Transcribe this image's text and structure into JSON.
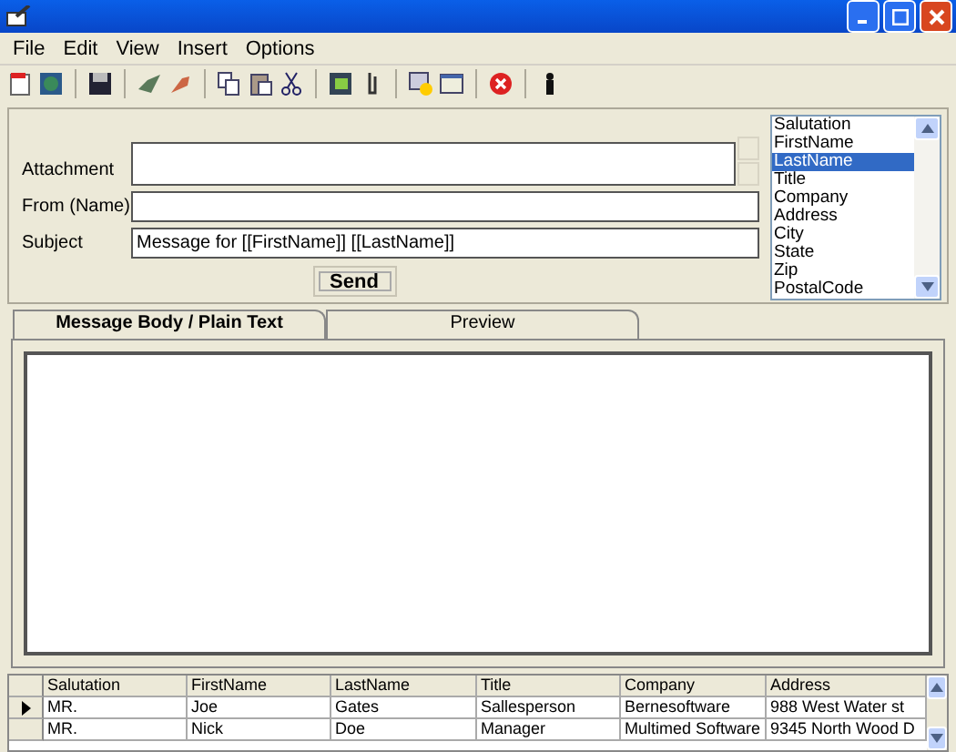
{
  "menu": [
    "File",
    "Edit",
    "View",
    "Insert",
    "Options"
  ],
  "form": {
    "fields": [
      {
        "label": "Attachment",
        "kind": "multi"
      },
      {
        "label": "From (Name)",
        "kind": "line"
      },
      {
        "label": "Subject",
        "value": "Message for [[FirstName]] [[LastName]]",
        "kind": "line"
      }
    ],
    "send": "Send",
    "field_list": [
      {
        "label": "Salutation",
        "selected": false
      },
      {
        "label": "FirstName",
        "selected": false
      },
      {
        "label": "LastName",
        "selected": true
      },
      {
        "label": "Title",
        "selected": false
      },
      {
        "label": "Company",
        "selected": false
      },
      {
        "label": "Address",
        "selected": false
      },
      {
        "label": "City",
        "selected": false
      },
      {
        "label": "State",
        "selected": false
      },
      {
        "label": "Zip",
        "selected": false
      },
      {
        "label": "PostalCode",
        "selected": false
      }
    ]
  },
  "tabs": [
    {
      "label": "Message Body / Plain Text",
      "selected": true
    },
    {
      "label": "Preview",
      "selected": false
    }
  ],
  "table": {
    "columns": [
      "Salutation",
      "FirstName",
      "LastName",
      "Title",
      "Company",
      "Address"
    ],
    "rows": [
      {
        "cells": [
          "MR.",
          "Joe",
          "Gates",
          "Sallesperson",
          "Bernesoftware",
          "988 West Water st"
        ],
        "selected": true
      },
      {
        "cells": [
          "MR.",
          "Nick",
          "Doe",
          "Manager",
          "Multimed Software",
          "9345 North Wood D"
        ],
        "selected": false
      }
    ]
  }
}
